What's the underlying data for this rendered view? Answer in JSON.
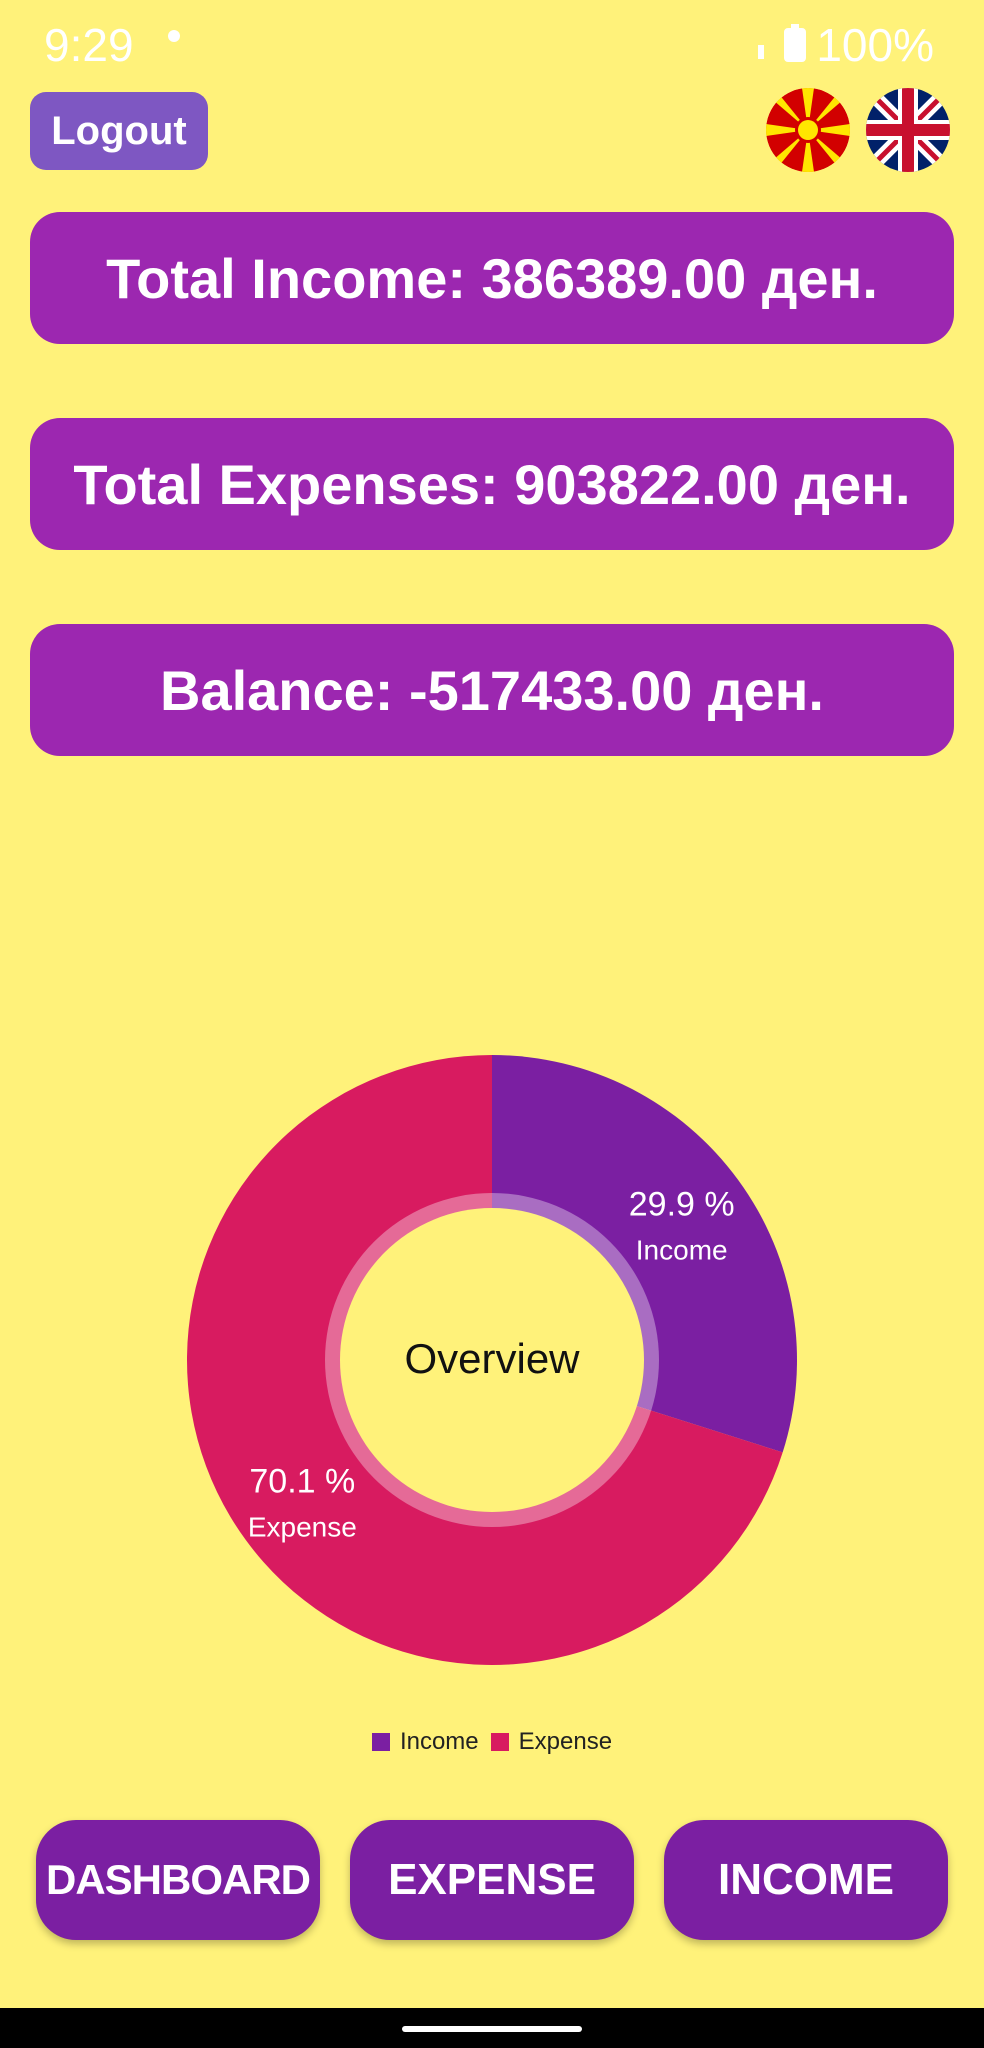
{
  "status_bar": {
    "time": "9:29",
    "battery": "100%"
  },
  "header": {
    "logout_label": "Logout"
  },
  "cards": {
    "total_income": "Total Income: 386389.00 ден.",
    "total_expenses": "Total Expenses: 903822.00 ден.",
    "balance": "Balance: -517433.00 ден."
  },
  "chart_data": {
    "type": "pie",
    "center_text": "Overview",
    "slices": [
      {
        "label": "Income",
        "value": 29.9,
        "percent_label": "29.9 %",
        "color": "#7B1FA2"
      },
      {
        "label": "Expense",
        "value": 70.1,
        "percent_label": "70.1 %",
        "color": "#D81B60"
      }
    ],
    "legend": [
      "Income",
      "Expense"
    ],
    "legend_placement": "bottom"
  },
  "nav": {
    "dashboard": "DASHBOARD",
    "expense": "EXPENSE",
    "income": "INCOME"
  },
  "colors": {
    "background": "#FFF27A",
    "card": "#9C27B0",
    "nav": "#7B1FA2",
    "logout": "#7E57C2"
  },
  "icons": {
    "flag_left": "macedonia-flag-icon",
    "flag_right": "uk-flag-icon"
  }
}
